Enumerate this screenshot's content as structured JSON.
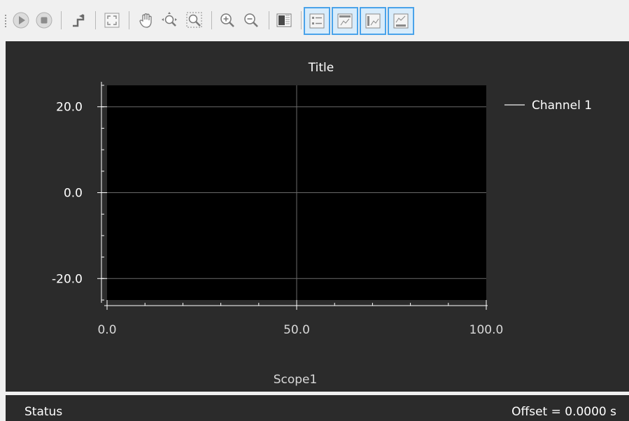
{
  "toolbar": {
    "buttons": [
      {
        "name": "run",
        "icon": "play-icon"
      },
      {
        "name": "stop",
        "icon": "stop-icon"
      },
      {
        "name": "step",
        "icon": "trigger-step-icon"
      },
      {
        "name": "fit",
        "icon": "fit-view-icon"
      },
      {
        "name": "pan",
        "icon": "hand-icon"
      },
      {
        "name": "zoom-xy",
        "icon": "zoom-xy-icon"
      },
      {
        "name": "zoom-box",
        "icon": "zoom-box-icon"
      },
      {
        "name": "zoom-in",
        "icon": "zoom-in-icon"
      },
      {
        "name": "zoom-out",
        "icon": "zoom-out-icon"
      },
      {
        "name": "layout",
        "icon": "layout-icon"
      },
      {
        "name": "legend",
        "icon": "legend-icon",
        "checked": true
      },
      {
        "name": "title",
        "icon": "title-icon",
        "checked": true
      },
      {
        "name": "y-axis",
        "icon": "y-axis-icon",
        "checked": true
      },
      {
        "name": "x-axis",
        "icon": "x-axis-icon",
        "checked": true
      }
    ]
  },
  "scope": {
    "caption": "Scope1"
  },
  "chart_data": {
    "type": "line",
    "title": "Title",
    "xlabel": "",
    "ylabel": "",
    "xlim": [
      0,
      100
    ],
    "ylim": [
      -25,
      25
    ],
    "x_ticks": [
      0,
      50,
      100
    ],
    "x_tick_labels": [
      "0.0",
      "50.0",
      "100.0"
    ],
    "y_ticks": [
      20,
      0,
      -20
    ],
    "y_tick_labels": [
      "20.0",
      "0.0",
      "-20.0"
    ],
    "grid": true,
    "legend": "right",
    "series": [
      {
        "name": "Channel 1",
        "x": [],
        "y": [],
        "color": "#cfcfcf"
      }
    ]
  },
  "colors": {
    "plot_bg": "#000000",
    "panel_bg": "#2b2b2b",
    "grid": "#6a6a6a",
    "text": "#ffffff",
    "accent": "#4aa3ea"
  },
  "status": {
    "left": "Status",
    "right": "Offset = 0.0000 s"
  }
}
